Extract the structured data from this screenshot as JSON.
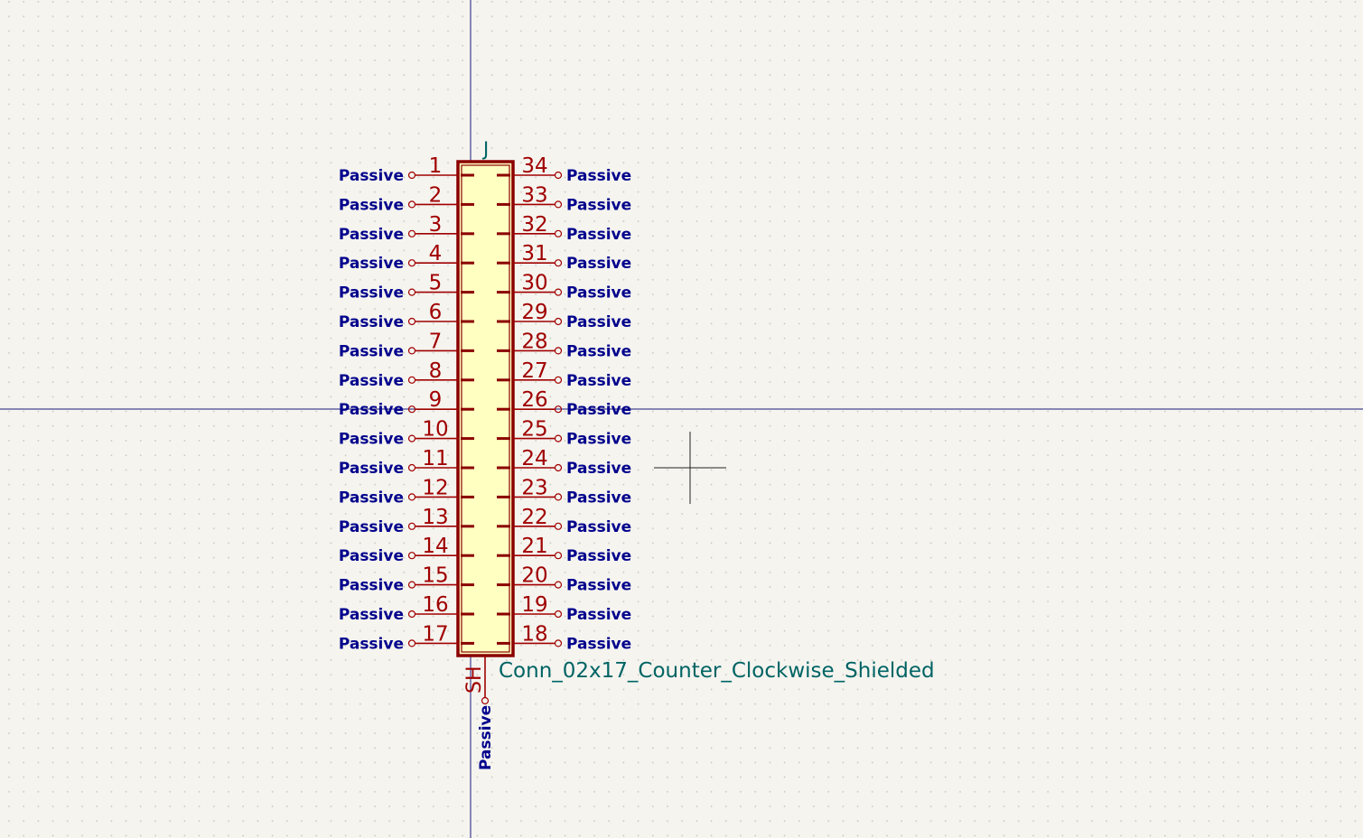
{
  "symbol": {
    "reference": "J",
    "value": "Conn_02x17_Counter_Clockwise_Shielded",
    "shield_pin": {
      "name": "SH",
      "type": "Passive"
    }
  },
  "pins_left": [
    {
      "number": "1",
      "type": "Passive"
    },
    {
      "number": "2",
      "type": "Passive"
    },
    {
      "number": "3",
      "type": "Passive"
    },
    {
      "number": "4",
      "type": "Passive"
    },
    {
      "number": "5",
      "type": "Passive"
    },
    {
      "number": "6",
      "type": "Passive"
    },
    {
      "number": "7",
      "type": "Passive"
    },
    {
      "number": "8",
      "type": "Passive"
    },
    {
      "number": "9",
      "type": "Passive"
    },
    {
      "number": "10",
      "type": "Passive"
    },
    {
      "number": "11",
      "type": "Passive"
    },
    {
      "number": "12",
      "type": "Passive"
    },
    {
      "number": "13",
      "type": "Passive"
    },
    {
      "number": "14",
      "type": "Passive"
    },
    {
      "number": "15",
      "type": "Passive"
    },
    {
      "number": "16",
      "type": "Passive"
    },
    {
      "number": "17",
      "type": "Passive"
    }
  ],
  "pins_right": [
    {
      "number": "34",
      "type": "Passive"
    },
    {
      "number": "33",
      "type": "Passive"
    },
    {
      "number": "32",
      "type": "Passive"
    },
    {
      "number": "31",
      "type": "Passive"
    },
    {
      "number": "30",
      "type": "Passive"
    },
    {
      "number": "29",
      "type": "Passive"
    },
    {
      "number": "28",
      "type": "Passive"
    },
    {
      "number": "27",
      "type": "Passive"
    },
    {
      "number": "26",
      "type": "Passive"
    },
    {
      "number": "25",
      "type": "Passive"
    },
    {
      "number": "24",
      "type": "Passive"
    },
    {
      "number": "23",
      "type": "Passive"
    },
    {
      "number": "22",
      "type": "Passive"
    },
    {
      "number": "21",
      "type": "Passive"
    },
    {
      "number": "20",
      "type": "Passive"
    },
    {
      "number": "19",
      "type": "Passive"
    },
    {
      "number": "18",
      "type": "Passive"
    }
  ],
  "colors": {
    "background": "#f5f4ef",
    "grid_dot": "#c9c8c0",
    "axis": "#1a1a7a",
    "body_outline": "#8b0000",
    "body_fill": "#ffffc2",
    "pin_line": "#a00000",
    "pin_number": "#a00000",
    "pin_type": "#00008c",
    "field_text": "#006464",
    "cursor": "#222222"
  }
}
